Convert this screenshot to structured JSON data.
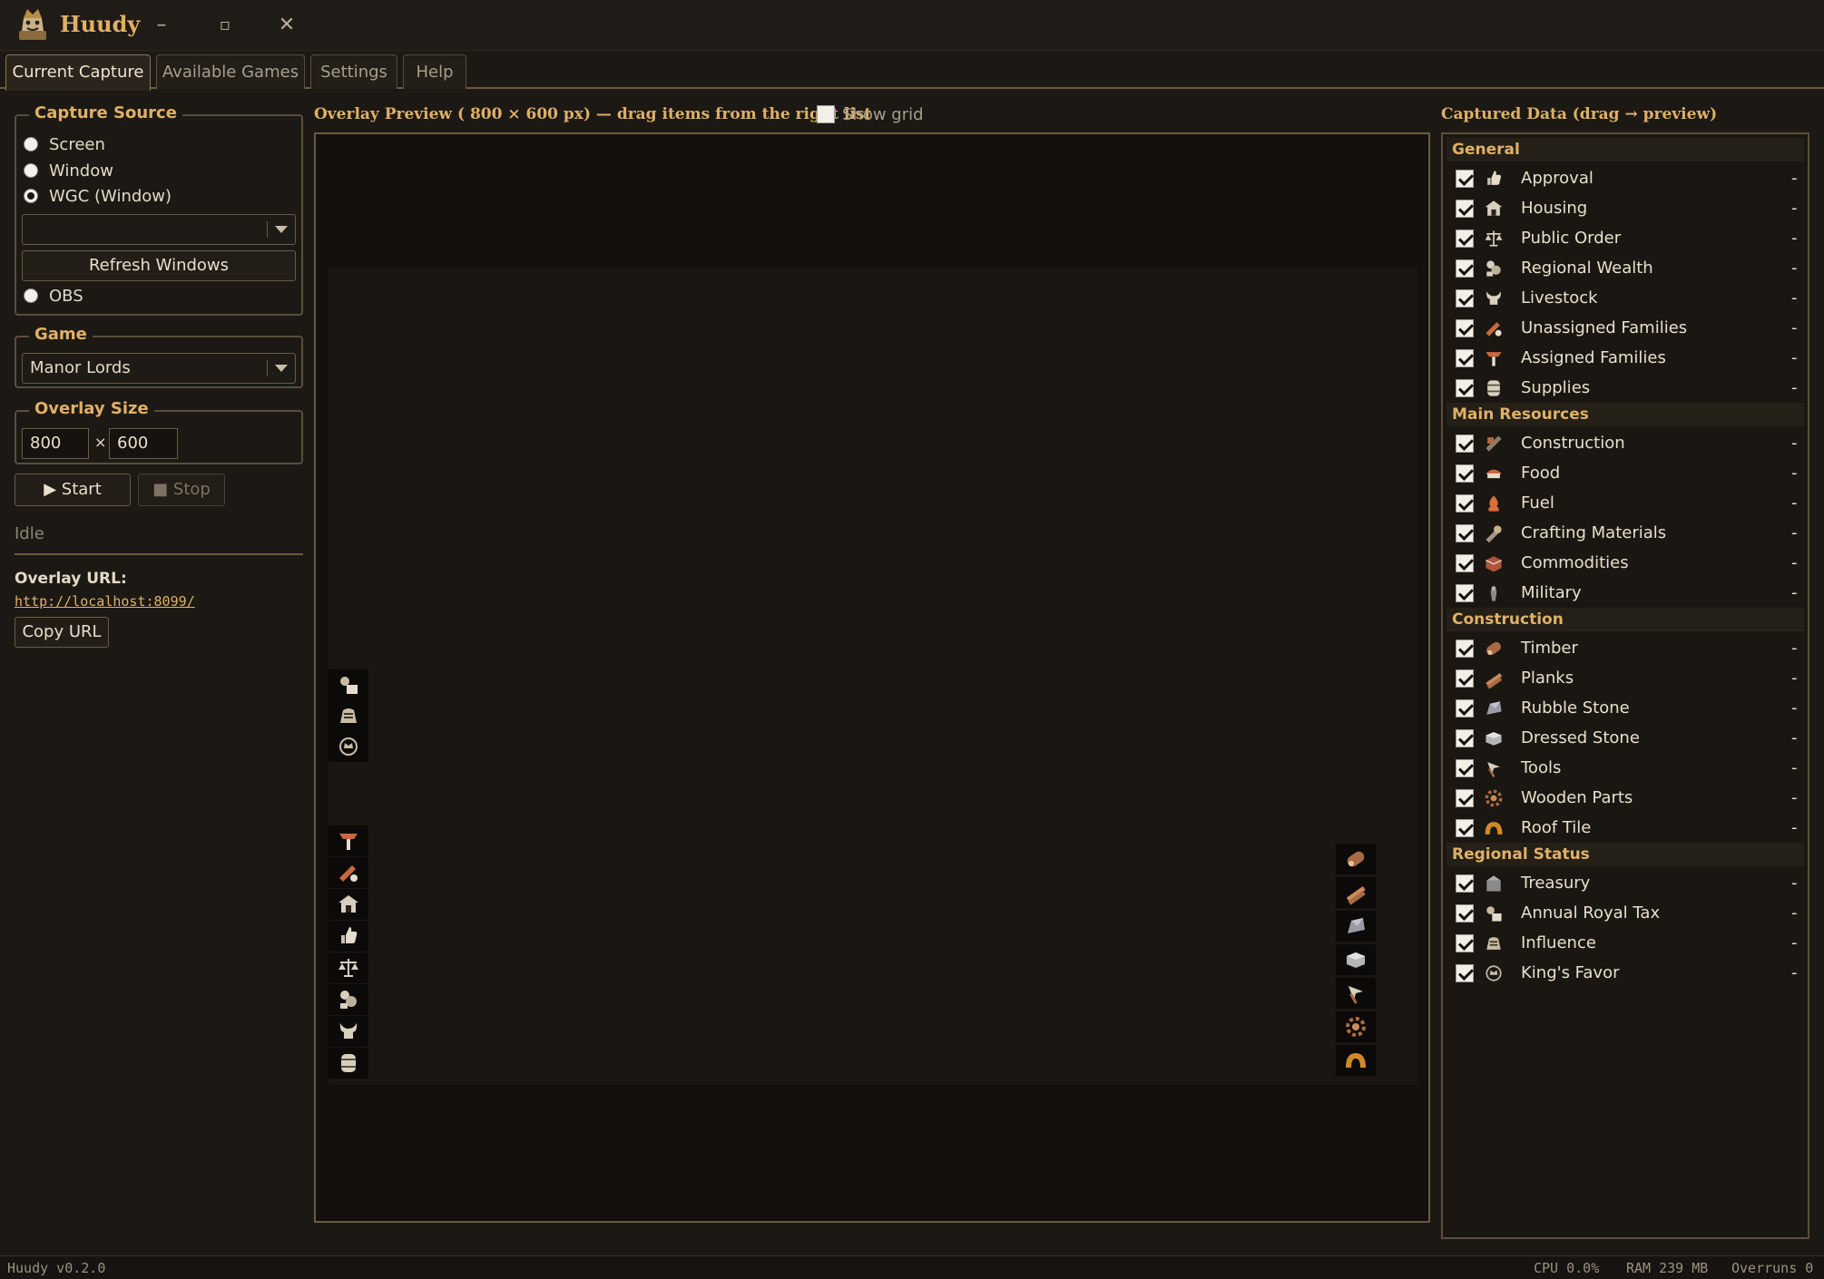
{
  "window": {
    "title": "Huudy",
    "minimize_glyph": "–",
    "maximize_glyph": "▫",
    "close_glyph": "✕"
  },
  "tabs": [
    "Current Capture",
    "Available Games",
    "Settings",
    "Help"
  ],
  "active_tab": "Current Capture",
  "capture_source": {
    "legend": "Capture Source",
    "options": [
      "Screen",
      "Window",
      "WGC (Window)",
      "OBS"
    ],
    "selected": "WGC (Window)",
    "window_combo_value": "",
    "refresh_label": "Refresh Windows"
  },
  "game": {
    "legend": "Game",
    "selected": "Manor Lords"
  },
  "overlay_size": {
    "legend": "Overlay Size",
    "width": "800",
    "separator": "×",
    "height": "600"
  },
  "controls": {
    "start_label": "▶ Start",
    "stop_label": "■ Stop",
    "stop_enabled": false,
    "status": "Idle"
  },
  "overlay_url": {
    "label": "Overlay URL:",
    "url": "http://localhost:8099/",
    "copy_label": "Copy URL"
  },
  "preview": {
    "heading": "Overlay Preview ( 800 × 600 px) — drag items from the right list",
    "show_grid_label": "Show grid",
    "show_grid_checked": false,
    "left_icons_top": [
      "royal-tax-icon",
      "influence-icon",
      "kings-favor-icon"
    ],
    "left_icons_bottom": [
      "assigned-families-icon",
      "unassigned-families-icon",
      "housing-icon",
      "approval-icon",
      "public-order-icon",
      "regional-wealth-icon",
      "livestock-icon",
      "supplies-icon"
    ],
    "right_icons": [
      "timber-icon",
      "planks-icon",
      "rubble-stone-icon",
      "dressed-stone-icon",
      "tools-icon",
      "wooden-parts-icon",
      "roof-tile-icon"
    ]
  },
  "captured_data": {
    "heading": "Captured Data  (drag → preview)",
    "categories": [
      {
        "name": "General",
        "items": [
          {
            "label": "Approval",
            "icon": "approval-icon",
            "checked": true,
            "value": "-"
          },
          {
            "label": "Housing",
            "icon": "housing-icon",
            "checked": true,
            "value": "-"
          },
          {
            "label": "Public Order",
            "icon": "public-order-icon",
            "checked": true,
            "value": "-"
          },
          {
            "label": "Regional Wealth",
            "icon": "regional-wealth-icon",
            "checked": true,
            "value": "-"
          },
          {
            "label": "Livestock",
            "icon": "livestock-icon",
            "checked": true,
            "value": "-"
          },
          {
            "label": "Unassigned Families",
            "icon": "unassigned-families-icon",
            "checked": true,
            "value": "-"
          },
          {
            "label": "Assigned Families",
            "icon": "assigned-families-icon",
            "checked": true,
            "value": "-"
          },
          {
            "label": "Supplies",
            "icon": "supplies-icon",
            "checked": true,
            "value": "-"
          }
        ]
      },
      {
        "name": "Main Resources",
        "items": [
          {
            "label": "Construction",
            "icon": "construction-icon",
            "checked": true,
            "value": "-"
          },
          {
            "label": "Food",
            "icon": "food-icon",
            "checked": true,
            "value": "-"
          },
          {
            "label": "Fuel",
            "icon": "fuel-icon",
            "checked": true,
            "value": "-"
          },
          {
            "label": "Crafting Materials",
            "icon": "crafting-materials-icon",
            "checked": true,
            "value": "-"
          },
          {
            "label": "Commodities",
            "icon": "commodities-icon",
            "checked": true,
            "value": "-"
          },
          {
            "label": "Military",
            "icon": "military-icon",
            "checked": true,
            "value": "-"
          }
        ]
      },
      {
        "name": "Construction",
        "items": [
          {
            "label": "Timber",
            "icon": "timber-icon",
            "checked": true,
            "value": "-"
          },
          {
            "label": "Planks",
            "icon": "planks-icon",
            "checked": true,
            "value": "-"
          },
          {
            "label": "Rubble Stone",
            "icon": "rubble-stone-icon",
            "checked": true,
            "value": "-"
          },
          {
            "label": "Dressed Stone",
            "icon": "dressed-stone-icon",
            "checked": true,
            "value": "-"
          },
          {
            "label": "Tools",
            "icon": "tools-icon",
            "checked": true,
            "value": "-"
          },
          {
            "label": "Wooden Parts",
            "icon": "wooden-parts-icon",
            "checked": true,
            "value": "-"
          },
          {
            "label": "Roof Tile",
            "icon": "roof-tile-icon",
            "checked": true,
            "value": "-"
          }
        ]
      },
      {
        "name": "Regional Status",
        "items": [
          {
            "label": "Treasury",
            "icon": "treasury-icon",
            "checked": true,
            "value": "-"
          },
          {
            "label": "Annual Royal Tax",
            "icon": "royal-tax-icon",
            "checked": true,
            "value": "-"
          },
          {
            "label": "Influence",
            "icon": "influence-icon",
            "checked": true,
            "value": "-"
          },
          {
            "label": "King's Favor",
            "icon": "kings-favor-icon",
            "checked": true,
            "value": "-"
          }
        ]
      }
    ]
  },
  "status_bar": {
    "version": "Huudy v0.2.0",
    "cpu": "CPU 0.0%",
    "ram": "RAM 239 MB",
    "overruns": "Overruns 0"
  },
  "colors": {
    "accent": "#e0b066",
    "background": "#1c1915",
    "panel": "#1a1713",
    "preview_canvas": "#1a1612",
    "border": "#6b5a3f"
  }
}
